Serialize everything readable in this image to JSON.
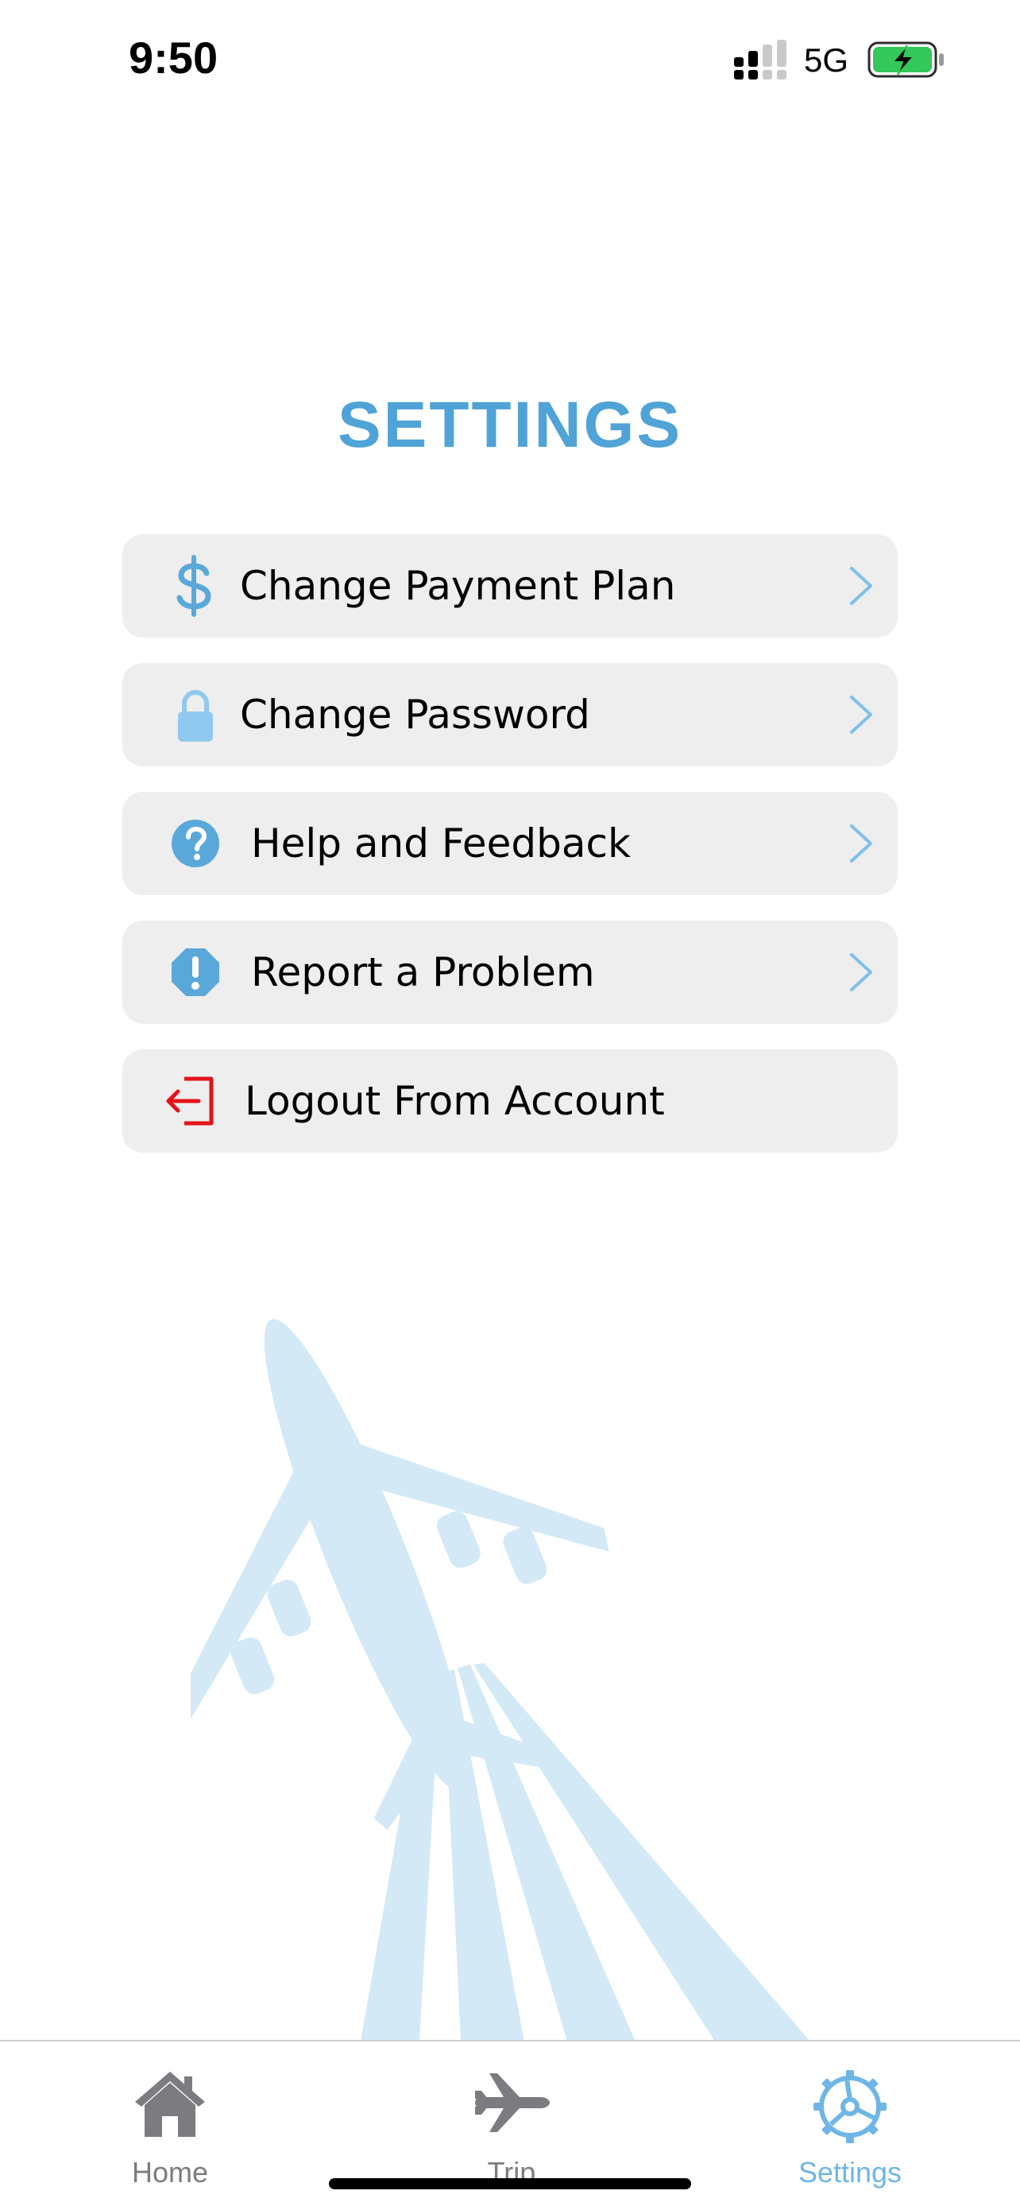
{
  "status_bar": {
    "time": "9:50",
    "network": "5G",
    "signal_icon": "cellular-signal-icon",
    "battery_icon": "battery-charging-icon",
    "battery_color": "#34c759"
  },
  "page": {
    "title": "SETTINGS",
    "accent_color": "#4fa3d6"
  },
  "menu": {
    "items": [
      {
        "label": "Change Payment Plan",
        "icon": "dollar-icon",
        "has_chevron": true
      },
      {
        "label": "Change Password",
        "icon": "lock-icon",
        "has_chevron": true
      },
      {
        "label": "Help and Feedback",
        "icon": "question-circle-icon",
        "has_chevron": true
      },
      {
        "label": "Report a Problem",
        "icon": "exclamation-octagon-icon",
        "has_chevron": true
      },
      {
        "label": "Logout From Account",
        "icon": "logout-icon",
        "has_chevron": false,
        "icon_color": "#e3131b"
      }
    ]
  },
  "illustration": {
    "icon": "airplane-takeoff-illustration",
    "color": "#d3e9f6"
  },
  "tab_bar": {
    "tabs": [
      {
        "label": "Home",
        "icon": "house-icon",
        "active": false
      },
      {
        "label": "Trip",
        "icon": "airplane-icon",
        "active": false
      },
      {
        "label": "Settings",
        "icon": "gear-icon",
        "active": true
      }
    ],
    "inactive_color": "#7c7c80",
    "active_color": "#6fb6e6"
  }
}
